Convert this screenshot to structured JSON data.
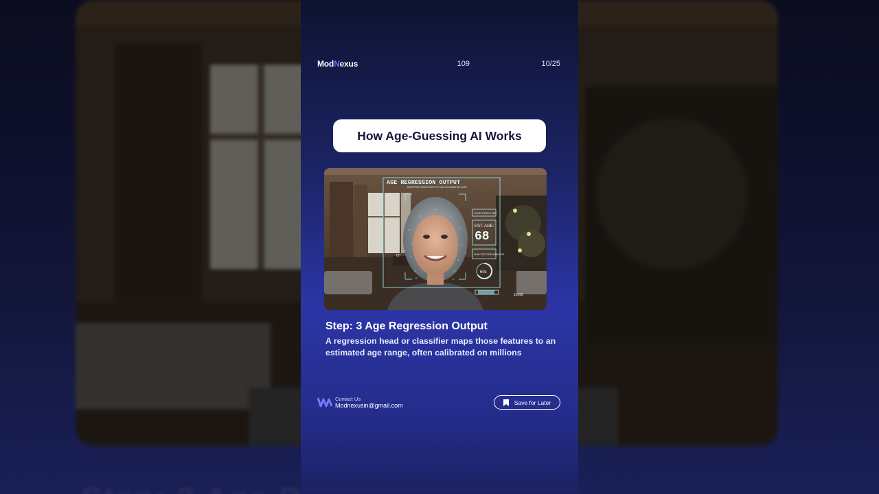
{
  "header": {
    "logo_prefix": "Mod",
    "logo_n": "N",
    "logo_suffix": "exus",
    "page_number": "109",
    "slide_counter": "10/25"
  },
  "title": "How Age-Guessing AI Works",
  "image_overlay": {
    "panel_title": "AGE REGRESSION OUTPUT",
    "panel_subtitle": "MAPPING FEATURES TO AN ESTIMATED AGE",
    "face_detected": "FACE DETECTED",
    "est_age_label": "EST. AGE:",
    "est_age_value": "68",
    "texture_label": "SKIN TEXTURE ANALYSIS",
    "decade": "60s",
    "code": "10108",
    "side_mark": "72°"
  },
  "step": {
    "title": "Step: 3 Age Regression Output",
    "body": "A regression head or classifier maps those features to an estimated age range, often calibrated on millions"
  },
  "footer": {
    "contact_label": "Contact Us",
    "contact_email": "Modnexusin@gmail.com",
    "save_label": "Save for Later"
  },
  "background": {
    "bottom_text": "Step: 3 Age R"
  },
  "colors": {
    "accent": "#7a6cff",
    "card_mid": "#2c35a6",
    "hud": "#9fe6f0"
  }
}
